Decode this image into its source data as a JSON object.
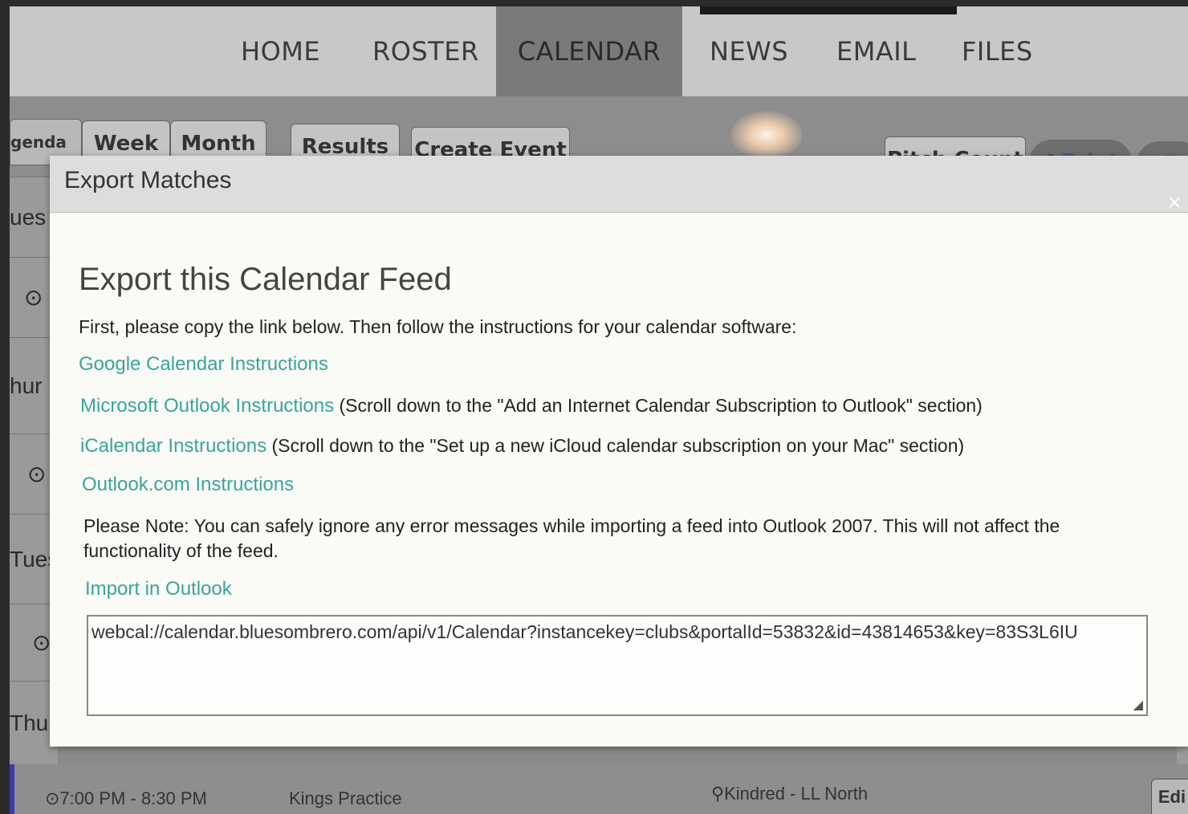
{
  "nav": {
    "items": [
      "HOME",
      "ROSTER",
      "CALENDAR",
      "NEWS",
      "EMAIL",
      "FILES"
    ],
    "active": "CALENDAR"
  },
  "toolbar": {
    "agenda": "genda",
    "week": "Week",
    "month": "Month",
    "results": "Results",
    "create_event": "Create Event",
    "pitch_count": "Pitch Count",
    "print": "Print",
    "export": "E"
  },
  "side_days": [
    "ues",
    "⊙",
    "hur",
    "⊙",
    "Tues",
    "⊙",
    "Thur"
  ],
  "bottom": {
    "time": "7:00 PM - 8:30 PM",
    "title": "Kings Practice",
    "location": "Kindred - LL North",
    "edit": "Edi"
  },
  "modal": {
    "title": "Export Matches",
    "close": "×",
    "heading": "Export this Calendar Feed",
    "intro": "First, please copy the link below. Then follow the instructions for your calendar software:",
    "google_link": "Google Calendar Instructions",
    "outlook_link": "Microsoft Outlook Instructions",
    "outlook_note": "(Scroll down to the \"Add an Internet Calendar Subscription to Outlook\" section)",
    "ical_link": "iCalendar Instructions",
    "ical_note": "(Scroll down to the \"Set up a new iCloud calendar subscription on your Mac\" section)",
    "outlookcom_link": "Outlook.com Instructions",
    "note": "Please Note: You can safely ignore any error messages while importing a feed into Outlook 2007. This will not affect the functionality of the feed.",
    "import_link": "Import in Outlook",
    "feed_url": "webcal://calendar.bluesombrero.com/api/v1/Calendar?instancekey=clubs&portalId=53832&id=43814653&key=83S3L6IU"
  }
}
